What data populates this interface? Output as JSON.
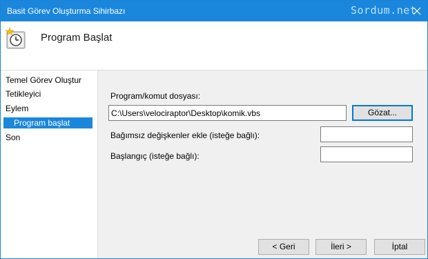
{
  "window": {
    "title": "Basit Görev Oluşturma Sihirbazı",
    "watermark": "Sordum.net"
  },
  "header": {
    "heading": "Program Başlat",
    "icon": "task-scheduler-clock-icon"
  },
  "sidebar": {
    "items": [
      {
        "label": "Temel Görev Oluştur",
        "selected": false
      },
      {
        "label": "Tetikleyici",
        "selected": false
      },
      {
        "label": "Eylem",
        "selected": false
      },
      {
        "label": "Program başlat",
        "selected": true
      },
      {
        "label": "Son",
        "selected": false
      }
    ]
  },
  "form": {
    "program_label": "Program/komut dosyası:",
    "program_value": "C:\\Users\\velociraptor\\Desktop\\komik.vbs",
    "browse_label": "Gözat...",
    "args_label": "Bağımsız değişkenler ekle (isteğe bağlı):",
    "args_value": "",
    "start_label": "Başlangıç (isteğe bağlı):",
    "start_value": ""
  },
  "footer": {
    "back_label": "< Geri",
    "next_label": "İleri >",
    "cancel_label": "İptal"
  },
  "colors": {
    "accent": "#1a87dd",
    "selection": "#1a87dd",
    "window_bg": "#f0f0f0"
  }
}
